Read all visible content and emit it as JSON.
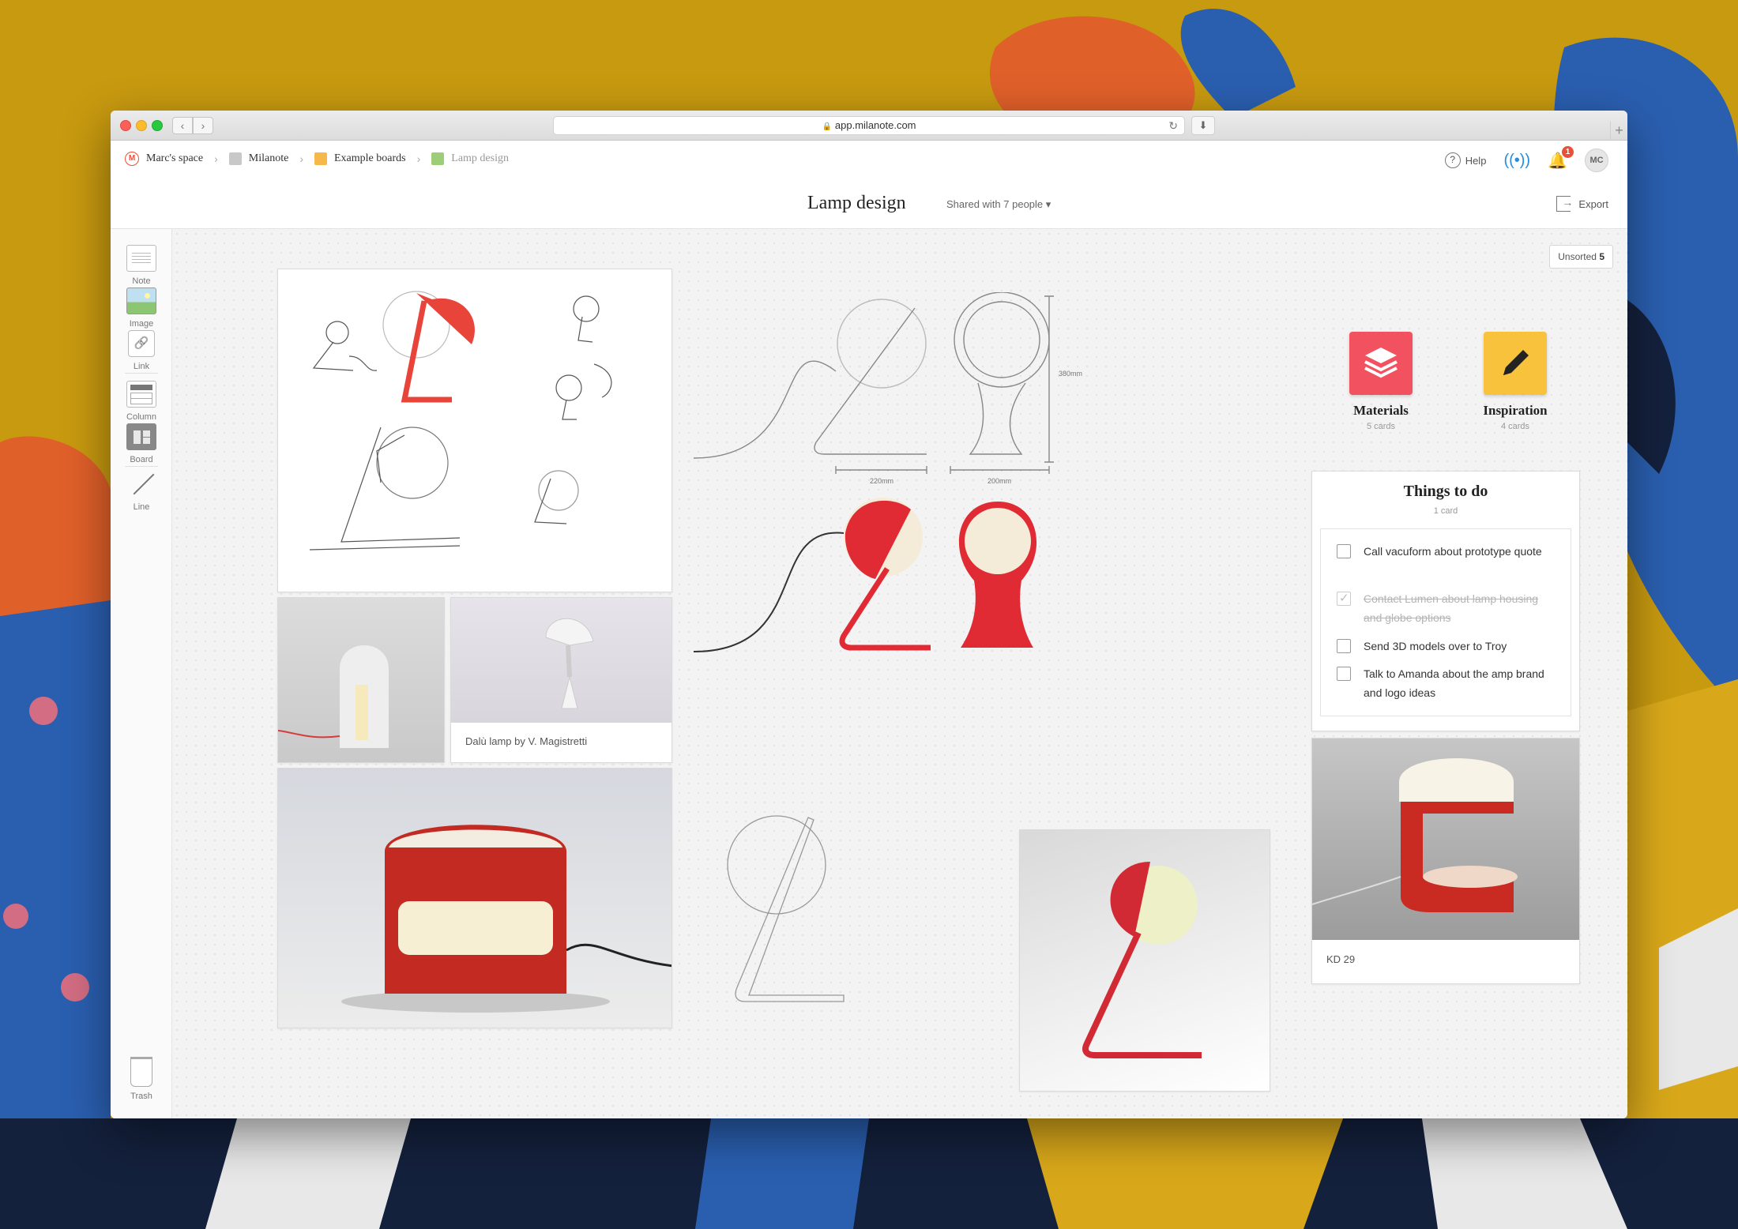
{
  "browser": {
    "url": "app.milanote.com"
  },
  "breadcrumbs": [
    {
      "label": "Marc's space",
      "color": "#e8503a"
    },
    {
      "label": "Milanote",
      "color": "#c8c8c8"
    },
    {
      "label": "Example boards",
      "color": "#f7b84a"
    },
    {
      "label": "Lamp design",
      "color": "#9cce78"
    }
  ],
  "topbar": {
    "help_label": "Help",
    "notification_count": "1",
    "avatar_initials": "MC"
  },
  "board": {
    "title": "Lamp design",
    "shared_label": "Shared with 7 people",
    "export_label": "Export",
    "unsorted_label": "Unsorted",
    "unsorted_count": "5"
  },
  "tools": [
    {
      "label": "Note",
      "icon": "note-icon"
    },
    {
      "label": "Image",
      "icon": "image-icon"
    },
    {
      "label": "Link",
      "icon": "link-icon"
    },
    {
      "label": "Column",
      "icon": "column-icon"
    },
    {
      "label": "Board",
      "icon": "board-icon"
    },
    {
      "label": "Line",
      "icon": "line-icon"
    }
  ],
  "trash_label": "Trash",
  "cards": {
    "dalu_caption": "Dalù lamp by V. Magistretti",
    "kd29_caption": "KD 29"
  },
  "technical_drawing": {
    "width_label": "220mm",
    "depth_label": "200mm",
    "height_label": "380mm"
  },
  "boards": [
    {
      "name": "Materials",
      "count": "5 cards",
      "color": "#f2525f",
      "icon": "layers-icon"
    },
    {
      "name": "Inspiration",
      "count": "4 cards",
      "color": "#f9c23c",
      "icon": "pencil-icon"
    }
  ],
  "todo": {
    "title": "Things to do",
    "count": "1 card",
    "items": [
      {
        "text": "Call vacuform about prototype quote",
        "done": false
      },
      {
        "text": "Contact Lumen about lamp housing and globe options",
        "done": true
      },
      {
        "text": "Send 3D models over to Troy",
        "done": false
      },
      {
        "text": "Talk to Amanda about the amp brand and logo ideas",
        "done": false
      }
    ]
  }
}
